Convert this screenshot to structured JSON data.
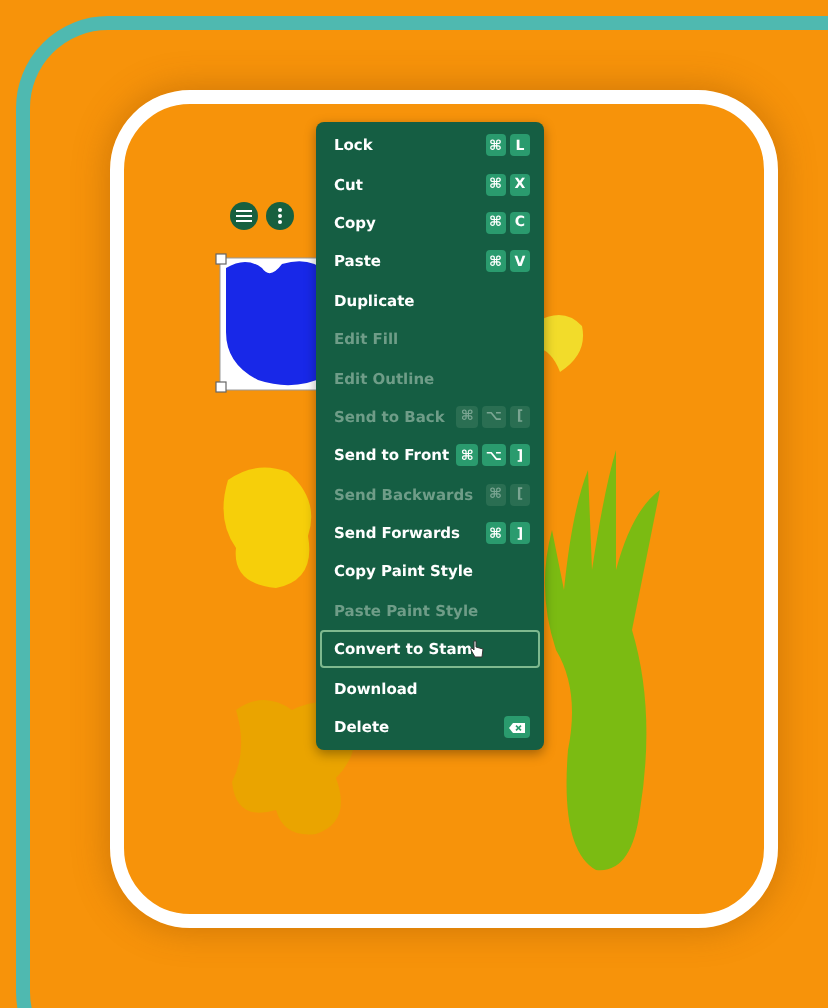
{
  "menu": [
    {
      "label": "Lock",
      "disabled": false,
      "hovered": false,
      "keys": [
        "⌘",
        "L"
      ]
    },
    {
      "label": "Cut",
      "disabled": false,
      "hovered": false,
      "keys": [
        "⌘",
        "X"
      ]
    },
    {
      "label": "Copy",
      "disabled": false,
      "hovered": false,
      "keys": [
        "⌘",
        "C"
      ]
    },
    {
      "label": "Paste",
      "disabled": false,
      "hovered": false,
      "keys": [
        "⌘",
        "V"
      ]
    },
    {
      "label": "Duplicate",
      "disabled": false,
      "hovered": false
    },
    {
      "label": "Edit Fill",
      "disabled": true,
      "hovered": false
    },
    {
      "label": "Edit Outline",
      "disabled": true,
      "hovered": false
    },
    {
      "label": "Send to Back",
      "disabled": true,
      "hovered": false,
      "keys": [
        "⌘",
        "⌥",
        "["
      ]
    },
    {
      "label": "Send to Front",
      "disabled": false,
      "hovered": false,
      "keys": [
        "⌘",
        "⌥",
        "]"
      ]
    },
    {
      "label": "Send Backwards",
      "disabled": true,
      "hovered": false,
      "keys": [
        "⌘",
        "["
      ]
    },
    {
      "label": "Send Forwards",
      "disabled": false,
      "hovered": false,
      "keys": [
        "⌘",
        "]"
      ]
    },
    {
      "label": "Copy Paint Style",
      "disabled": false,
      "hovered": false
    },
    {
      "label": "Paste Paint Style",
      "disabled": true,
      "hovered": false
    },
    {
      "label": "Convert to Stam",
      "disabled": false,
      "hovered": true
    },
    {
      "label": "Download",
      "disabled": false,
      "hovered": false
    },
    {
      "label": "Delete",
      "disabled": false,
      "hovered": false,
      "kind": "delete"
    }
  ]
}
